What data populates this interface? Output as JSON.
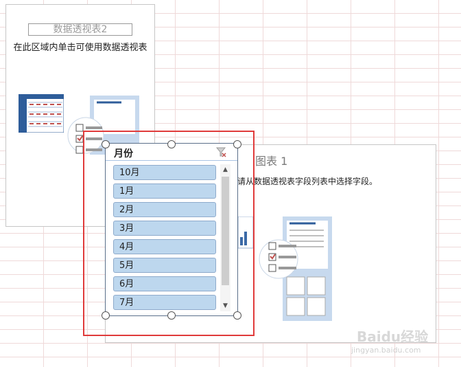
{
  "pivot_table_1": {
    "title": "数据透视表2",
    "hint": "在此区域内单击可使用数据透视表"
  },
  "pivot_chart_1": {
    "title": "图表 1",
    "hint": "请从数据透视表字段列表中选择字段。"
  },
  "slicer": {
    "title": "月份",
    "items": [
      "10月",
      "1月",
      "2月",
      "3月",
      "4月",
      "5月",
      "6月",
      "7月"
    ]
  },
  "watermark": {
    "brand": "Baidu经验",
    "url": "jingyan.baidu.com"
  },
  "colors": {
    "slicer_item_bg": "#bdd7ee",
    "highlight_box": "#e03a3a",
    "grid_line": "#efd9d9"
  }
}
